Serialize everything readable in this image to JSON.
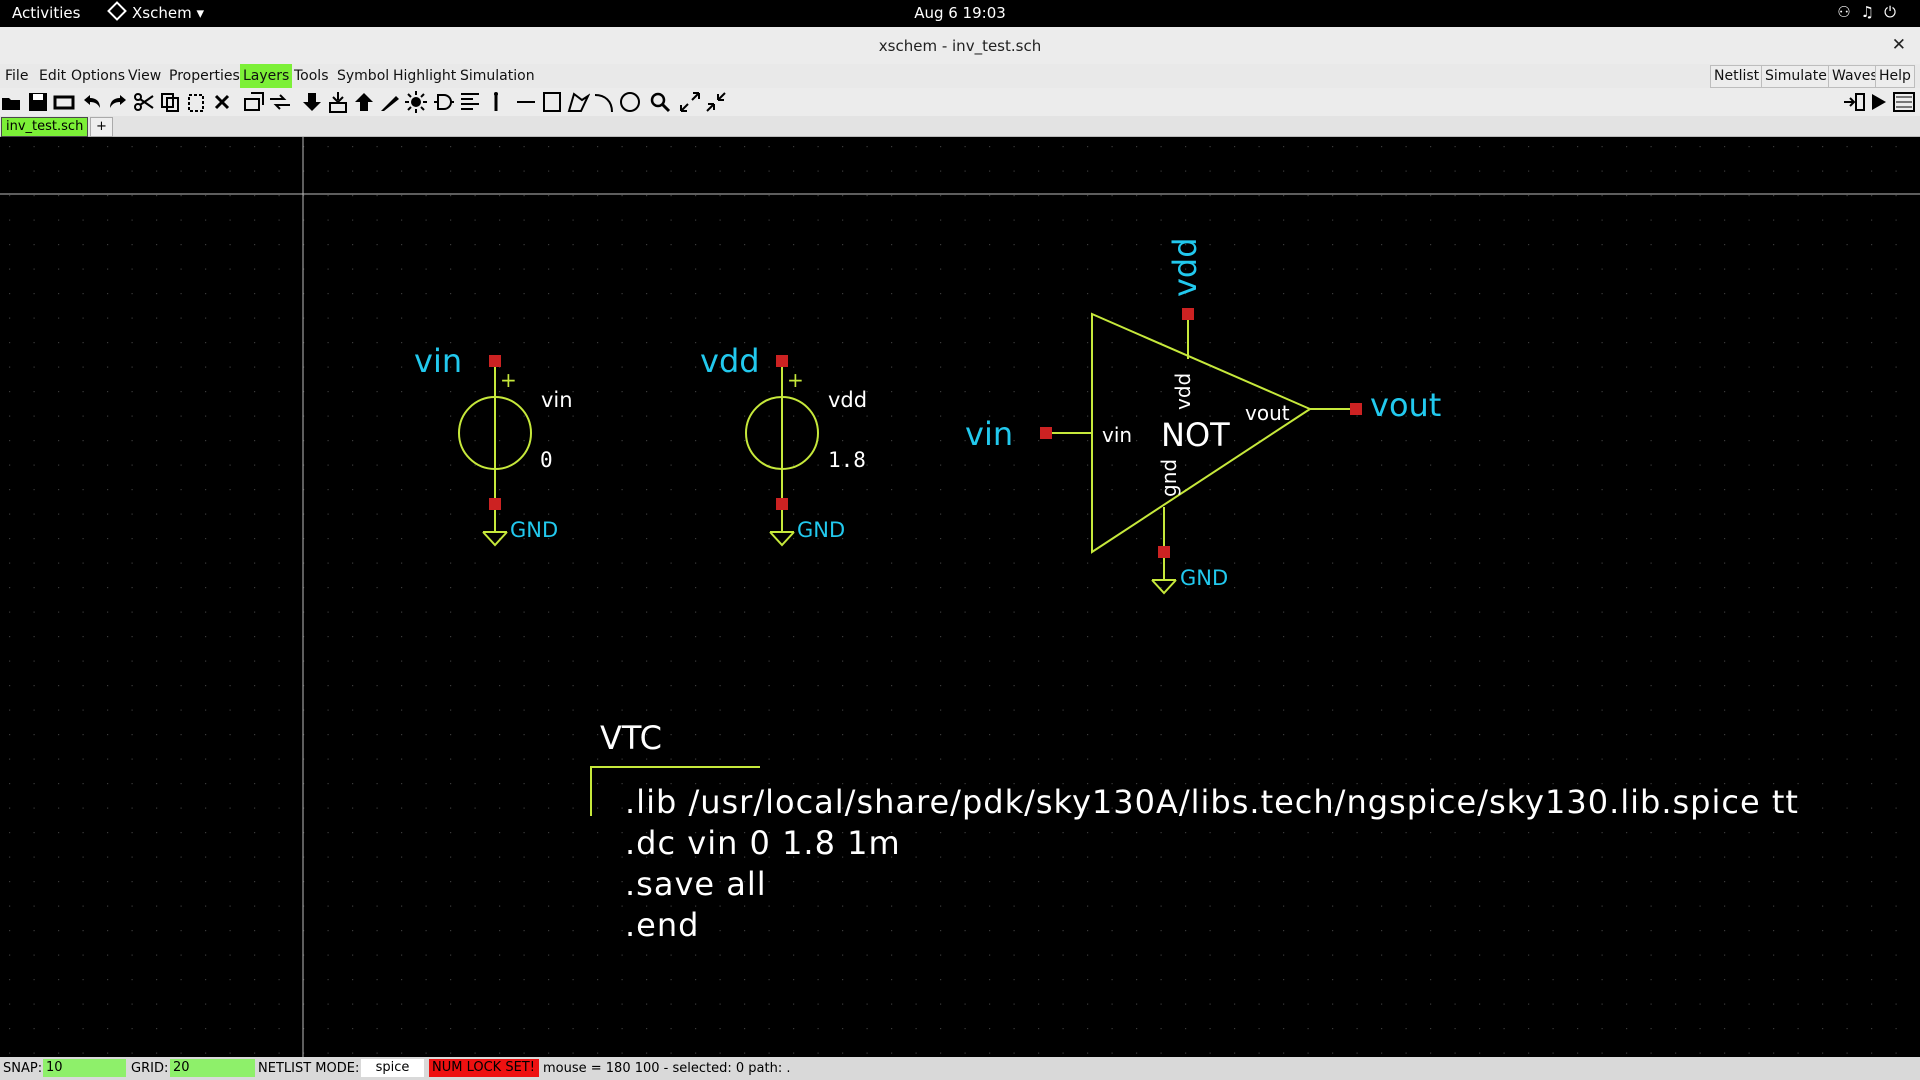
{
  "topbar": {
    "activities": "Activities",
    "app": "Xschem ▾",
    "clock": "Aug 6  19:03"
  },
  "window": {
    "title": "xschem - inv_test.sch",
    "close": "✕"
  },
  "menus": [
    "File",
    "Edit",
    "Options",
    "View",
    "Properties",
    "Layers",
    "Tools",
    "Symbol",
    "Highlight",
    "Simulation"
  ],
  "right_buttons": [
    "Netlist",
    "Simulate",
    "Waves",
    "Help"
  ],
  "tabs": {
    "active": "inv_test.sch",
    "add": "+"
  },
  "schematic": {
    "src_vin": {
      "net_top": "vin",
      "name": "vin",
      "value": "0",
      "gnd": "GND"
    },
    "src_vdd": {
      "net_top": "vdd",
      "name": "vdd",
      "value": "1.8",
      "gnd": "GND"
    },
    "inverter": {
      "label": "NOT",
      "pin_in": "vin",
      "pin_out": "vout",
      "pin_vdd": "vdd",
      "pin_gnd": "gnd",
      "net_in": "vin",
      "net_out": "vout",
      "net_vdd": "vdd",
      "gnd": "GND"
    },
    "code_block": {
      "title": "VTC",
      "lines": [
        ".lib /usr/local/share/pdk/sky130A/libs.tech/ngspice/sky130.lib.spice tt",
        ".dc vin 0 1.8 1m",
        ".save all",
        ".end"
      ]
    }
  },
  "status": {
    "snap_label": "SNAP:",
    "snap_value": "10",
    "grid_label": "GRID:",
    "grid_value": "20",
    "netlist_label": "NETLIST MODE:",
    "netlist_value": "spice",
    "numlock": "NUM LOCK SET!",
    "info": "mouse = 180 100 - selected: 0 path: ."
  },
  "colors": {
    "wire": "#c6e83b",
    "net_label": "#22c9ee",
    "pin": "#cc2222",
    "text": "#ffffff",
    "active": "#7cf037",
    "numlock": "#ee1111"
  }
}
